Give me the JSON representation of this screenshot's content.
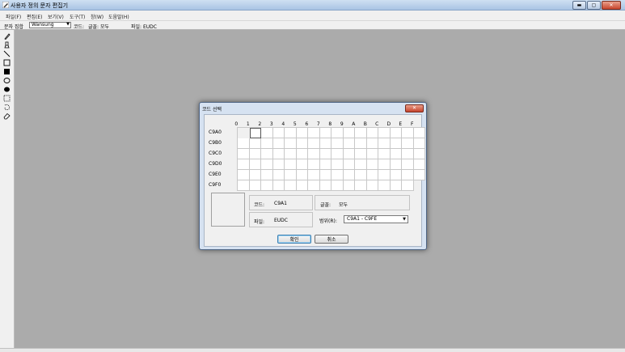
{
  "window": {
    "title": "사용자 정의 문자 편집기",
    "icon": "pencil-app-icon"
  },
  "window_buttons": {
    "minimize": "▬",
    "maximize": "▢",
    "close": "✕"
  },
  "menu": [
    "파일(F)",
    "편집(E)",
    "보기(V)",
    "도구(T)",
    "창(W)",
    "도움말(H)"
  ],
  "toolbar": {
    "charset_label": "문자 집합",
    "charset_value": "Wansung",
    "code_label": "코드:",
    "font_label": "글꼴: 모두",
    "file_label": "파일: EUDC"
  },
  "tools": [
    "pencil-icon",
    "brush-icon",
    "line-icon",
    "hollow-rectangle-icon",
    "filled-rectangle-icon",
    "hollow-ellipse-icon",
    "filled-ellipse-icon",
    "rect-selection-icon",
    "freeform-selection-icon",
    "eraser-icon"
  ],
  "dialog": {
    "title": "코드 선택",
    "close": "✕",
    "columns": [
      "0",
      "1",
      "2",
      "3",
      "4",
      "5",
      "6",
      "7",
      "8",
      "9",
      "A",
      "B",
      "C",
      "D",
      "E",
      "F"
    ],
    "rows": [
      "C9A0",
      "C9B0",
      "C9C0",
      "C9D0",
      "C9E0",
      "C9F0"
    ],
    "selected_code": "C9A1",
    "code_label": "코드:",
    "code_value": "C9A1",
    "font_label": "글꼴:",
    "font_value": "모두",
    "file_label": "파일:",
    "file_value": "EUDC",
    "range_label": "범위(R):",
    "range_value": "C9A1 - C9FE",
    "ok": "확인",
    "cancel": "취소"
  },
  "colors": {
    "workspace": "#ababab",
    "dialog_frame": "#d6e2f1",
    "close_red": "#c8462e"
  }
}
